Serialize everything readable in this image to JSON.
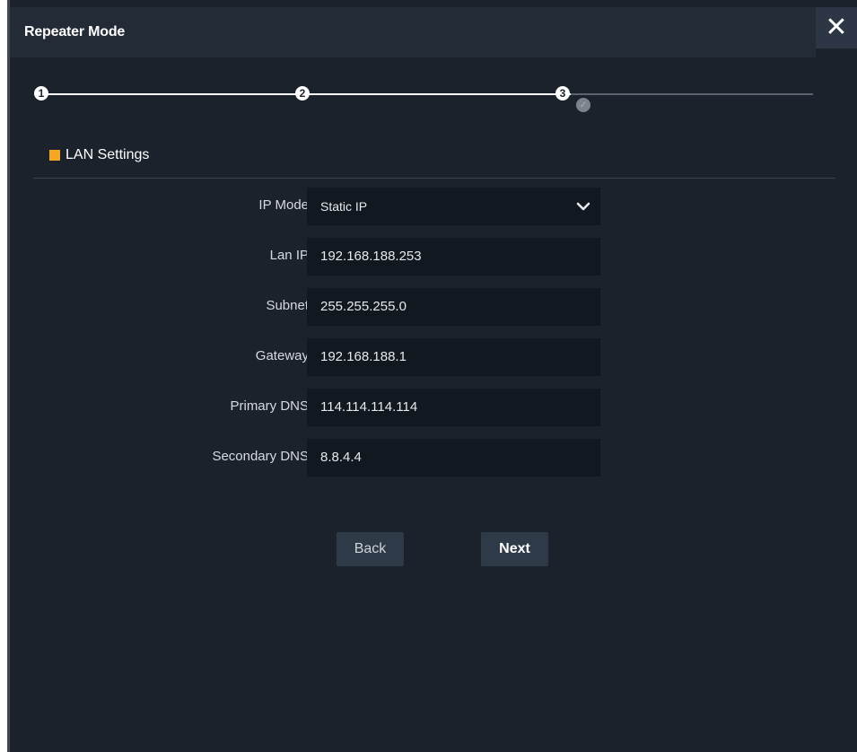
{
  "window": {
    "title": "Repeater Mode",
    "close_label": "✕"
  },
  "stepper": {
    "steps": [
      "1",
      "2",
      "3"
    ],
    "pending_icon": "✓"
  },
  "section": {
    "title": "LAN Settings",
    "marker_color": "#f5a623"
  },
  "form": {
    "ip_mode": {
      "label": "IP Mode",
      "value": "Static IP"
    },
    "lan_ip": {
      "label": "Lan IP",
      "value": "192.168.188.253"
    },
    "subnet": {
      "label": "Subnet",
      "value": "255.255.255.0"
    },
    "gateway": {
      "label": "Gateway",
      "value": "192.168.188.1"
    },
    "primary_dns": {
      "label": "Primary DNS",
      "value": "114.114.114.114"
    },
    "secondary_dns": {
      "label": "Secondary DNS",
      "value": "8.8.4.4"
    }
  },
  "buttons": {
    "back_label": "Back",
    "next_label": "Next"
  },
  "colors": {
    "background": "#1c222b",
    "title_bar": "#232b36",
    "field_bg": "#121820",
    "accent": "#f5a623"
  }
}
